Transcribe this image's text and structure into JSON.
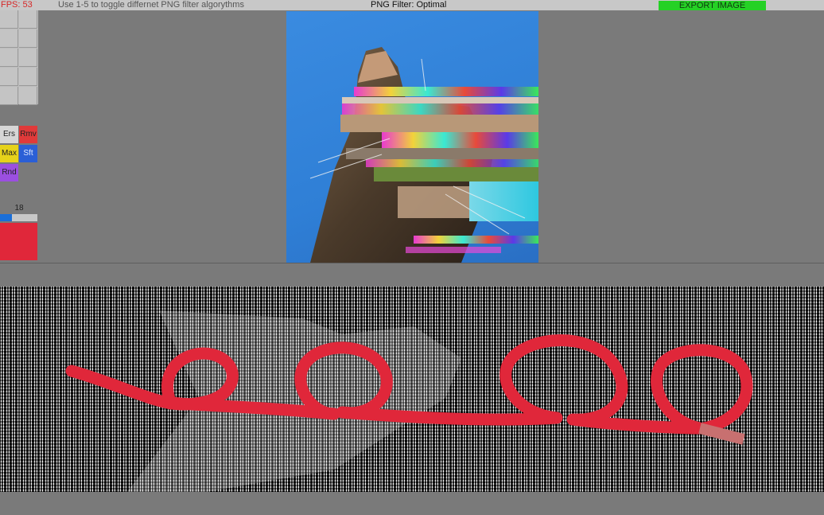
{
  "topbar": {
    "fps": "FPS: 53",
    "hint": "Use 1-5 to toggle differnet PNG filter algorythms",
    "filter_label": "PNG Filter: Optimal",
    "export_label": "EXPORT IMAGE"
  },
  "tools": {
    "erase": "Ers",
    "remove": "Rmv",
    "max": "Max",
    "shift": "Sft",
    "random": "Rnd"
  },
  "brush": {
    "size": "18",
    "slider_fraction": 0.32,
    "color": "#e0273a"
  },
  "colors": {
    "accent_green": "#25d125",
    "fps_red": "#d62828",
    "brush_red": "#e0273a",
    "remove_red": "#e03a3a",
    "max_yellow": "#e6d21a",
    "shift_blue": "#2b5fd6",
    "random_purple": "#9b4fe0"
  }
}
